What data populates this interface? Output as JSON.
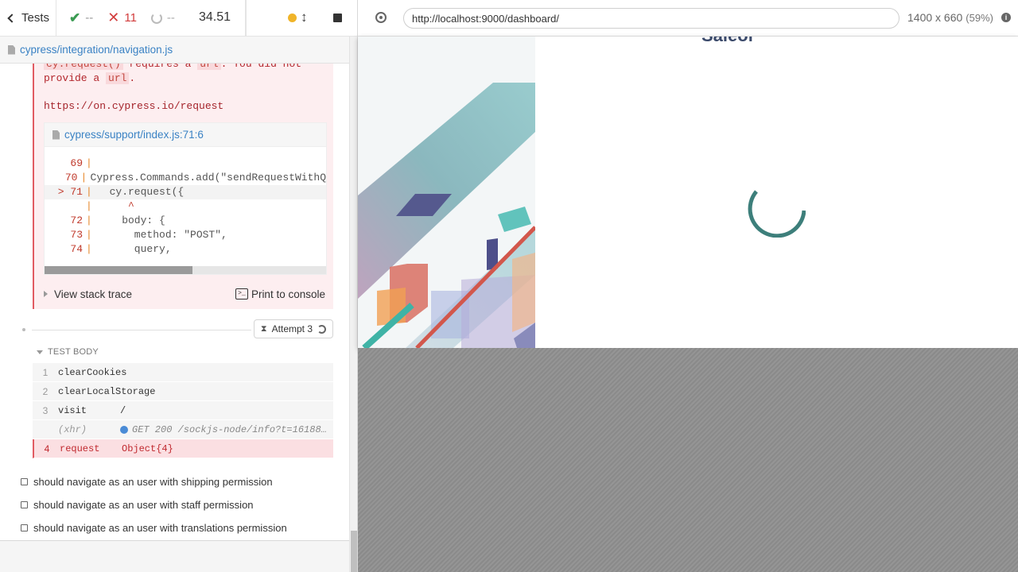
{
  "reporter": {
    "tests_label": "Tests",
    "stats": {
      "passed": "--",
      "failed": "11",
      "pending": "--"
    },
    "duration": "34.51",
    "spec_file": "cypress/integration/navigation.js",
    "error": {
      "line1_pre": "cy.request()",
      "line1_mid": " requires a ",
      "line1_code": "url",
      "line1_post": ". You did not",
      "line2_pre": "provide a ",
      "line2_code": "url",
      "line2_post": ".",
      "docs_link": "https://on.cypress.io/request",
      "codeframe_file": "cypress/support/index.js:71:6",
      "code_lines": [
        {
          "num": "69",
          "marker": "|",
          "code": ""
        },
        {
          "num": "70",
          "marker": "|",
          "code": "Cypress.Commands.add(\"sendRequestWithQ"
        },
        {
          "num": "> 71",
          "marker": "|",
          "code": "  cy.request({"
        },
        {
          "num": "",
          "marker": "|",
          "code": "     ^"
        },
        {
          "num": "72",
          "marker": "|",
          "code": "    body: {"
        },
        {
          "num": "73",
          "marker": "|",
          "code": "      method: \"POST\","
        },
        {
          "num": "74",
          "marker": "|",
          "code": "      query,"
        }
      ],
      "view_stack_trace": "View stack trace",
      "print_to_console": "Print to console"
    },
    "attempt_label": "Attempt 3",
    "test_body_label": "TEST BODY",
    "commands": [
      {
        "num": "1",
        "name": "clearCookies",
        "msg": ""
      },
      {
        "num": "2",
        "name": "clearLocalStorage",
        "msg": ""
      },
      {
        "num": "3",
        "name": "visit",
        "msg": "/"
      },
      {
        "num": "",
        "name": "(xhr)",
        "msg": "GET 200 /sockjs-node/info?t=16188…"
      },
      {
        "num": "4",
        "name": "request",
        "msg": "Object{4}"
      }
    ],
    "pending_tests": [
      "should navigate as an user with shipping permission",
      "should navigate as an user with staff permission",
      "should navigate as an user with translations permission"
    ]
  },
  "aut": {
    "url": "http://localhost:9000/dashboard/",
    "viewport_size": "1400 x 660",
    "viewport_scale": "(59%)",
    "peek_text": "Saleor"
  },
  "colors": {
    "fail_red": "#d23c3c",
    "pass_green": "#3a9b52",
    "link_blue": "#3a82c4",
    "spinner_teal": "#3d7f7b"
  }
}
